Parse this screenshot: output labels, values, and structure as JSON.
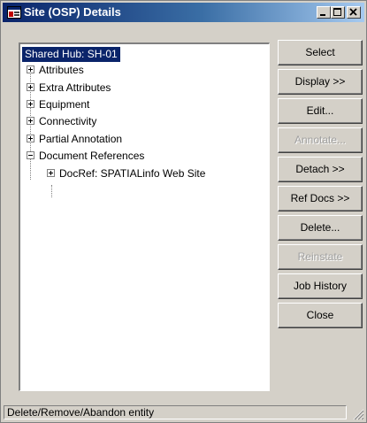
{
  "window": {
    "title": "Site (OSP) Details",
    "app_icon": "window-app-icon",
    "controls": [
      "minimize-icon",
      "maximize-icon",
      "close-icon"
    ]
  },
  "tree": {
    "root_label": "Shared Hub: SH-01",
    "nodes": [
      {
        "label": "Attributes",
        "state": "collapsed"
      },
      {
        "label": "Extra Attributes",
        "state": "collapsed"
      },
      {
        "label": "Equipment",
        "state": "collapsed"
      },
      {
        "label": "Connectivity",
        "state": "collapsed"
      },
      {
        "label": "Partial Annotation",
        "state": "collapsed"
      },
      {
        "label": "Document References",
        "state": "expanded",
        "children": [
          {
            "label": "DocRef: SPATIALinfo Web Site",
            "state": "collapsed"
          }
        ]
      }
    ]
  },
  "buttons": [
    {
      "label": "Select",
      "enabled": true
    },
    {
      "label": "Display >>",
      "enabled": true
    },
    {
      "label": "Edit...",
      "enabled": true
    },
    {
      "label": "Annotate...",
      "enabled": false
    },
    {
      "label": "Detach >>",
      "enabled": true
    },
    {
      "label": "Ref Docs >>",
      "enabled": true
    },
    {
      "label": "Delete...",
      "enabled": true
    },
    {
      "label": "Reinstate",
      "enabled": false
    },
    {
      "label": "Job History",
      "enabled": true
    },
    {
      "label": "Close",
      "enabled": true
    }
  ],
  "status_bar": {
    "text": "Delete/Remove/Abandon entity"
  },
  "colors": {
    "title_gradient_start": "#0a246a",
    "title_gradient_end": "#a6caf0",
    "selection": "#0a246a",
    "face": "#d4d0c8",
    "disabled_text": "#a0a0a0"
  }
}
